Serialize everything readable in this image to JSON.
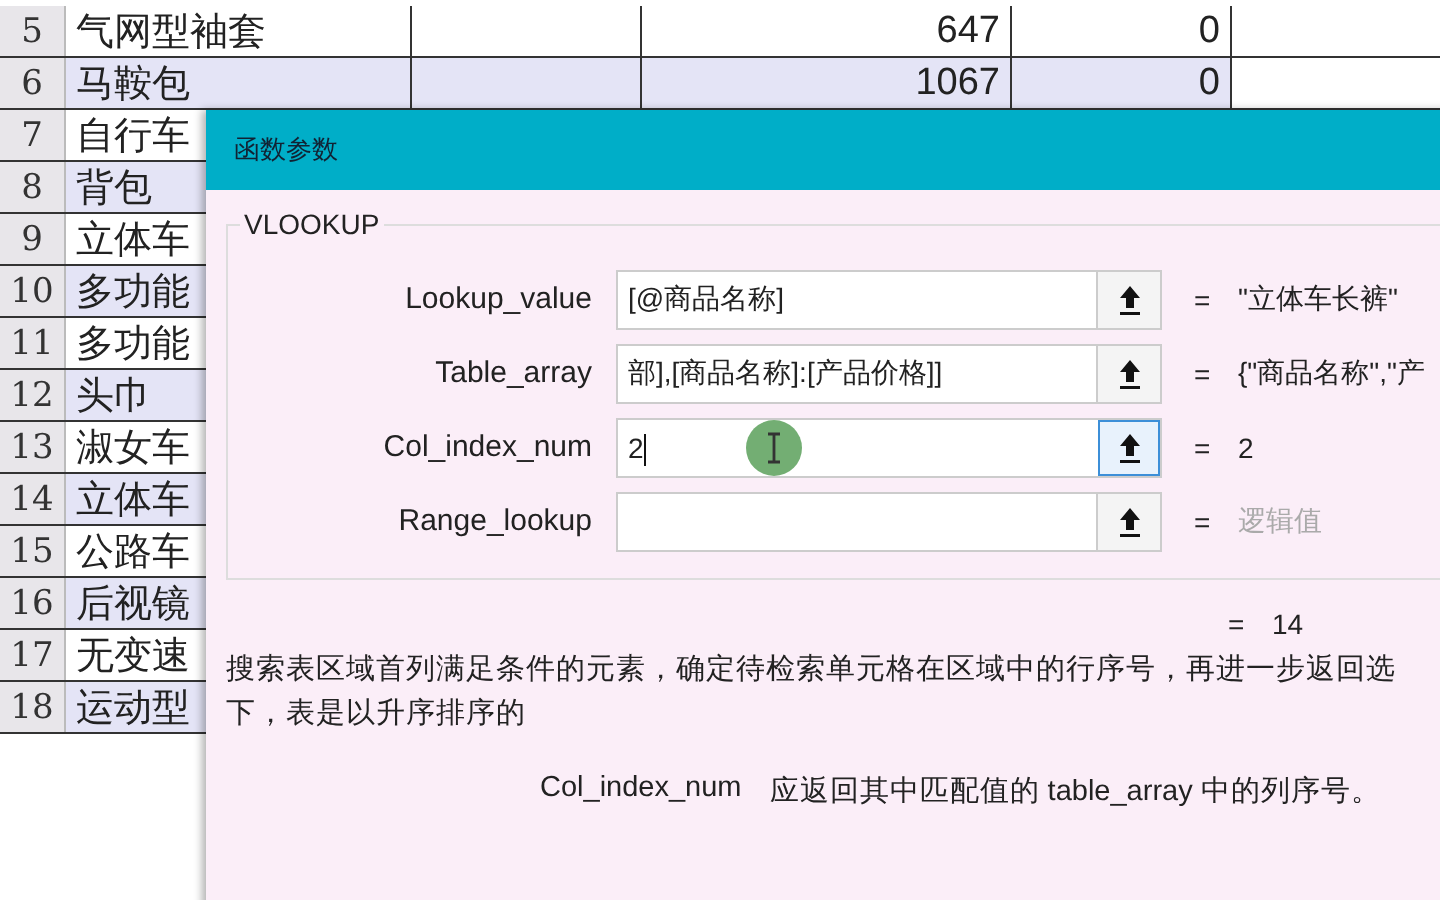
{
  "sheet": {
    "rows": [
      {
        "number": "5",
        "cells": [
          "气网型袖套",
          "",
          "647",
          "0"
        ]
      },
      {
        "number": "6",
        "cells": [
          "马鞍包",
          "",
          "1067",
          "0"
        ]
      },
      {
        "number": "7",
        "cells": [
          "自行车"
        ]
      },
      {
        "number": "8",
        "cells": [
          "背包"
        ]
      },
      {
        "number": "9",
        "cells": [
          "立体车"
        ]
      },
      {
        "number": "10",
        "cells": [
          "多功能"
        ]
      },
      {
        "number": "11",
        "cells": [
          "多功能"
        ]
      },
      {
        "number": "12",
        "cells": [
          "头巾"
        ]
      },
      {
        "number": "13",
        "cells": [
          "淑女车"
        ]
      },
      {
        "number": "14",
        "cells": [
          "立体车"
        ]
      },
      {
        "number": "15",
        "cells": [
          "公路车"
        ]
      },
      {
        "number": "16",
        "cells": [
          "后视镜"
        ]
      },
      {
        "number": "17",
        "cells": [
          "无变速"
        ]
      },
      {
        "number": "18",
        "cells": [
          "运动型"
        ]
      }
    ]
  },
  "dialog": {
    "title": "函数参数",
    "function_name": "VLOOKUP",
    "arguments": [
      {
        "label": "Lookup_value",
        "value": "[@商品名称]",
        "focused": false,
        "result": "\"立体车长裤\"",
        "hint": false
      },
      {
        "label": "Table_array",
        "value": "部],[商品名称]:[产品价格]]",
        "focused": false,
        "result": "{\"商品名称\",\"产",
        "hint": false
      },
      {
        "label": "Col_index_num",
        "value": "2",
        "focused": true,
        "result": "2",
        "hint": false
      },
      {
        "label": "Range_lookup",
        "focused": false,
        "result": "逻辑值",
        "hint": true
      }
    ],
    "equals": "=",
    "formula_result": "14",
    "description": "搜索表区域首列满足条件的元素，确定待检索单元格在区域中的行序号，再进一步返回选",
    "description_line2": "下，表是以升序排序的",
    "help_argument": "Col_index_num",
    "help_text": "应返回其中匹配值的 table_array 中的列序号。"
  }
}
